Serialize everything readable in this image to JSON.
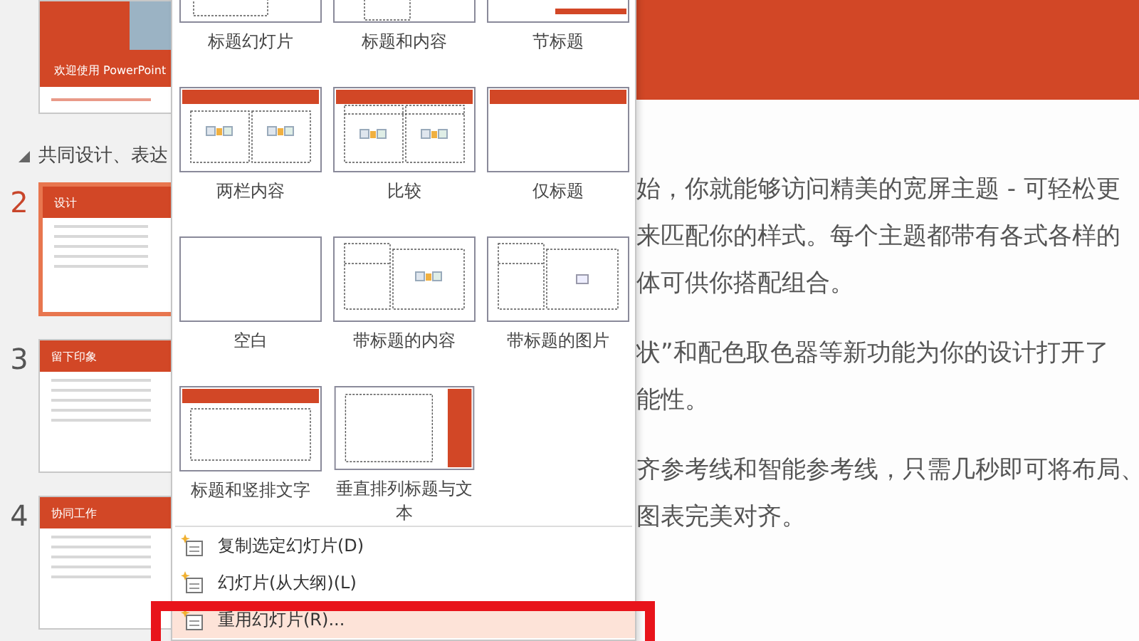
{
  "slide_panel": {
    "items": [
      {
        "kind": "title-slide",
        "title": "欢迎使用 PowerPoint",
        "selected": false
      },
      {
        "kind": "section",
        "label": "共同设计、表达",
        "expanded": true
      },
      {
        "kind": "content-slide",
        "number": "2",
        "title": "设计",
        "selected": true
      },
      {
        "kind": "content-slide",
        "number": "3",
        "title": "留下印象",
        "selected": false
      },
      {
        "kind": "content-slide",
        "number": "4",
        "title": "协同工作",
        "selected": false
      }
    ]
  },
  "layout_menu": {
    "layouts": [
      {
        "label": "标题幻灯片",
        "kind": "title-slide"
      },
      {
        "label": "标题和内容",
        "kind": "title-content"
      },
      {
        "label": "节标题",
        "kind": "section-header"
      },
      {
        "label": "两栏内容",
        "kind": "two-content"
      },
      {
        "label": "比较",
        "kind": "comparison"
      },
      {
        "label": "仅标题",
        "kind": "title-only"
      },
      {
        "label": "空白",
        "kind": "blank"
      },
      {
        "label": "带标题的内容",
        "kind": "content-caption"
      },
      {
        "label": "带标题的图片",
        "kind": "picture-caption"
      },
      {
        "label": "标题和竖排文字",
        "kind": "title-vertical-text"
      },
      {
        "label": "垂直排列标题与文本",
        "kind": "vertical-title-text"
      }
    ],
    "items": [
      {
        "label": "复制选定幻灯片(D)",
        "highlighted": false
      },
      {
        "label": "幻灯片(从大纲)(L)",
        "highlighted": false
      },
      {
        "label": "重用幻灯片(R)...",
        "highlighted": true
      }
    ]
  },
  "slide": {
    "paragraphs": [
      {
        "lines": [
          "始，你就能够访问精美的宽屏主题 - 可轻松更",
          "来匹配你的样式。每个主题都带有各式各样的",
          "体可供你搭配组合。"
        ]
      },
      {
        "lines": [
          "状”和配色取色器等新功能为你的设计打开了",
          "能性。"
        ]
      },
      {
        "lines": [
          "齐参考线和智能参考线，只需几秒即可将布局、",
          "图表完美对齐。"
        ]
      }
    ]
  }
}
